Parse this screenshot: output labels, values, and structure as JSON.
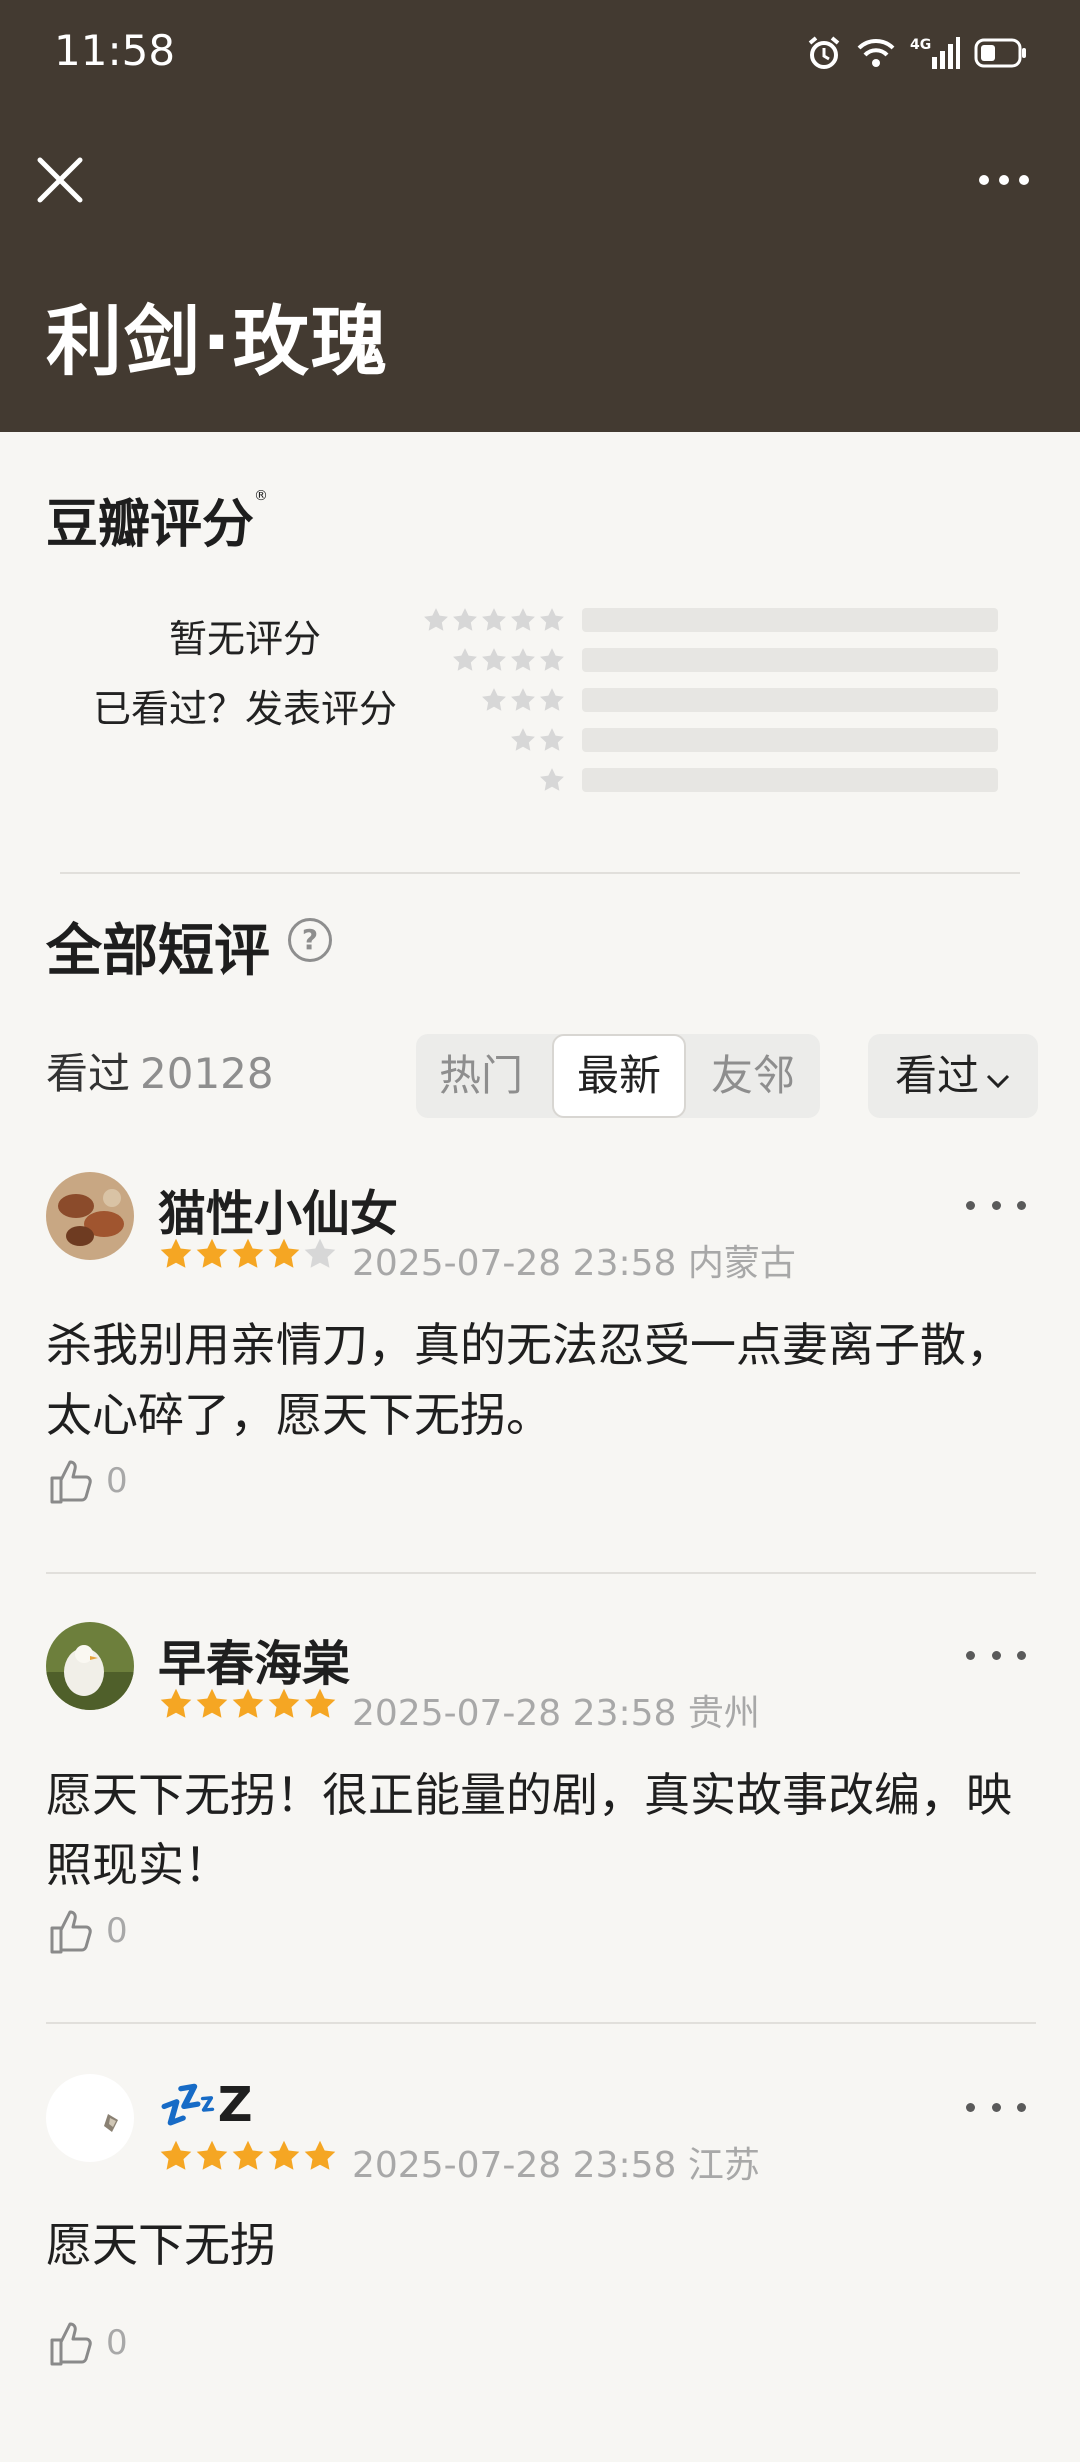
{
  "status_bar": {
    "time": "11:58"
  },
  "header": {
    "title": "利剑·玫瑰"
  },
  "rating": {
    "brand": "豆瓣评分",
    "registered_mark": "®",
    "no_rating": "暂无评分",
    "rate_prompt": "已看过？发表评分",
    "distribution": [
      0,
      0,
      0,
      0,
      0
    ]
  },
  "comments_section": {
    "title": "全部短评",
    "help_icon": "question-circle-icon",
    "seen_label": "看过",
    "seen_count": "20128",
    "tabs": [
      "热门",
      "最新",
      "友邻"
    ],
    "active_tab": "最新",
    "filter_label": "看过",
    "filter_icon": "chevron-down-icon"
  },
  "comments": [
    {
      "user": "猫性小仙女",
      "rating": 4,
      "date": "2025-07-28 23:58",
      "location": "内蒙古",
      "text": "杀我别用亲情刀，真的无法忍受一点妻离子散，太心碎了，愿天下无拐。",
      "likes": "0"
    },
    {
      "user": "早春海棠",
      "rating": 5,
      "date": "2025-07-28 23:58",
      "location": "贵州",
      "text": "愿天下无拐！很正能量的剧，真实故事改编，映照现实！",
      "likes": "0"
    },
    {
      "user": "💤Z",
      "rating": 5,
      "date": "2025-07-28 23:58",
      "location": "江苏",
      "text": "愿天下无拐",
      "likes": "0"
    }
  ],
  "colors": {
    "header_bg": "#433a31",
    "star": "#f5a623",
    "star_empty": "#d7d7d7",
    "page_bg": "#f7f6f3"
  }
}
